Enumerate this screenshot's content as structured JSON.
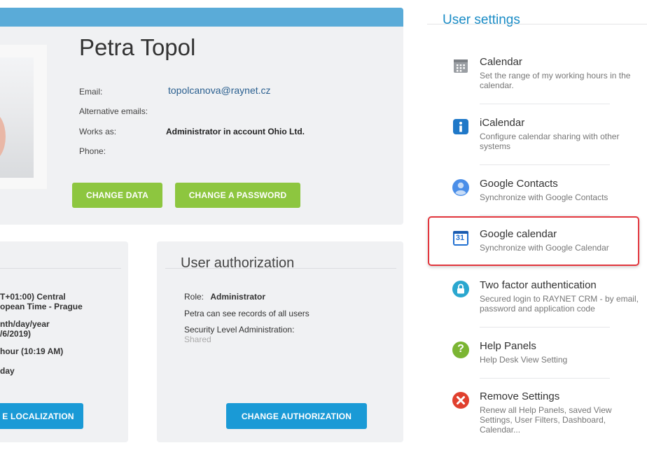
{
  "profile": {
    "name": "Petra Topol",
    "email_label": "Email:",
    "email": "topolcanova@raynet.cz",
    "alt_emails_label": "Alternative emails:",
    "works_as_label": "Works as:",
    "works_as": "Administrator in account Ohio Ltd.",
    "phone_label": "Phone:",
    "change_data": "CHANGE DATA",
    "change_password": "CHANGE A PASSWORD"
  },
  "localization": {
    "timezone_line1": "T+01:00) Central",
    "timezone_line2": "opean Time - Prague",
    "date_line1": "nth/day/year",
    "date_line2": "/6/2019)",
    "time_format": "hour (10:19 AM)",
    "first_day": "day",
    "change_button": "E LOCALIZATION"
  },
  "authorization": {
    "title": "User authorization",
    "role_label": "Role:",
    "role_value": "Administrator",
    "records_text": "Petra can see records of all users",
    "security_label": "Security Level Administration:",
    "security_value": "Shared",
    "change_button": "CHANGE AUTHORIZATION"
  },
  "settings": {
    "title": "User settings",
    "items": [
      {
        "icon": "calendar-icon",
        "title": "Calendar",
        "desc": "Set the range of my working hours in the calendar."
      },
      {
        "icon": "info-icon",
        "title": "iCalendar",
        "desc": "Configure calendar sharing with other systems"
      },
      {
        "icon": "contacts-icon",
        "title": "Google Contacts",
        "desc": "Synchronize with Google Contacts"
      },
      {
        "icon": "google-calendar-icon",
        "title": "Google calendar",
        "desc": "Synchronize with Google Calendar",
        "icon_text": "31"
      },
      {
        "icon": "lock-icon",
        "title": "Two factor authentication",
        "desc": "Secured login to RAYNET CRM - by email, password and application code"
      },
      {
        "icon": "help-icon",
        "title": "Help Panels",
        "desc": "Help Desk View Setting",
        "icon_text": "?"
      },
      {
        "icon": "remove-icon",
        "title": "Remove Settings",
        "desc": "Renew all Help Panels, saved View Settings, User Filters, Dashboard, Calendar..."
      }
    ]
  },
  "colors": {
    "accent_blue": "#1a8cc6",
    "green_button": "#8dc63f",
    "blue_button": "#1a9ad6",
    "highlight_red": "#e2363d"
  }
}
